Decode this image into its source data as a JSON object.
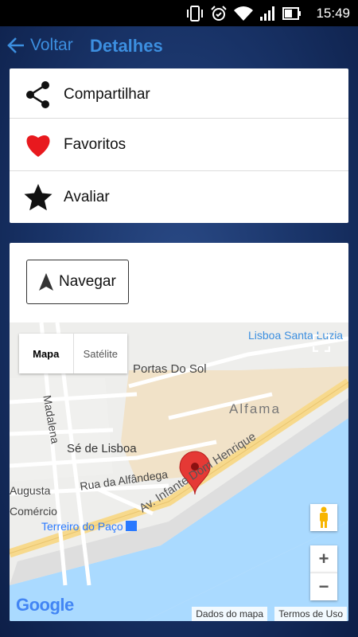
{
  "status": {
    "time": "15:49"
  },
  "header": {
    "back_label": "Voltar",
    "title": "Detalhes"
  },
  "actions": [
    {
      "label": "Compartilhar",
      "icon": "share-icon"
    },
    {
      "label": "Favoritos",
      "icon": "heart-icon",
      "color": "#e8191e"
    },
    {
      "label": "Avaliar",
      "icon": "star-icon"
    }
  ],
  "navigate_label": "Navegar",
  "map": {
    "type_options": [
      "Mapa",
      "Satélite"
    ],
    "selected_type": "Mapa",
    "labels": {
      "lisboa": "Lisboa Santa Luzia",
      "portas": "Portas Do Sol",
      "alfama": "Alfama",
      "madalena": "Madalena",
      "se": "Sé de Lisboa",
      "augusta": "Augusta",
      "alfandega": "Rua da Alfândega",
      "infante": "Av. Infante Dom Henrique",
      "comercio": "Comércio",
      "terreiro": "Terreiro do Paço"
    },
    "zoom_in": "+",
    "zoom_out": "−",
    "google": "Google",
    "attribution": [
      "Dados do mapa",
      "Termos de Uso"
    ]
  },
  "colors": {
    "accent": "#3c8fe0",
    "marker": "#e53935",
    "water": "#aadaff"
  }
}
